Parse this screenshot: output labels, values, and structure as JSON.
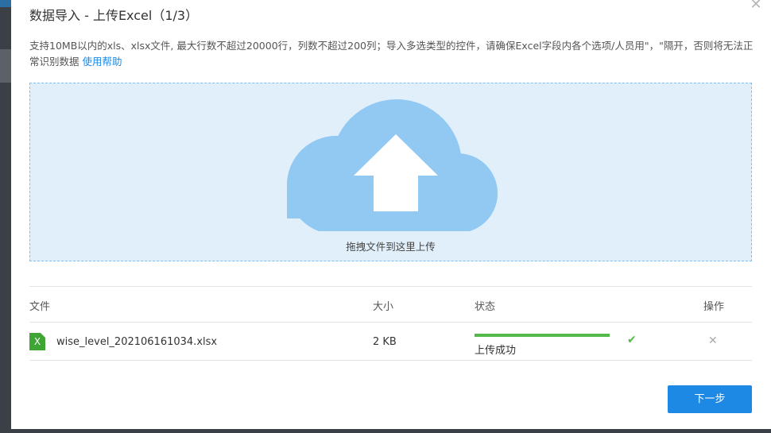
{
  "dialog": {
    "title": "数据导入 - 上传Excel（1/3）",
    "close_icon": "close-icon",
    "description": "支持10MB以内的xls、xlsx文件, 最大行数不超过20000行，列数不超过200列；导入多选类型的控件，请确保Excel字段内各个选项/人员用\"，\"隔开，否则将无法正常识别数据",
    "help_link": "使用帮助"
  },
  "dropzone": {
    "icon": "cloud-upload-icon",
    "text": "拖拽文件到这里上传",
    "colors": {
      "background": "#e1effb",
      "border": "#7ec0ef",
      "cloud": "#91c9f3"
    }
  },
  "table": {
    "headers": {
      "file": "文件",
      "size": "大小",
      "status": "状态",
      "action": "操作"
    },
    "rows": [
      {
        "icon": "excel-file-icon",
        "icon_label": "X",
        "file_name": "wise_level_202106161034.xlsx",
        "size": "2 KB",
        "progress_percent": 100,
        "status": "上传成功",
        "status_icon": "check-icon",
        "delete_icon": "delete-icon"
      }
    ]
  },
  "footer": {
    "next_label": "下一步"
  },
  "colors": {
    "accent": "#1e88e5",
    "success": "#52b94a"
  }
}
